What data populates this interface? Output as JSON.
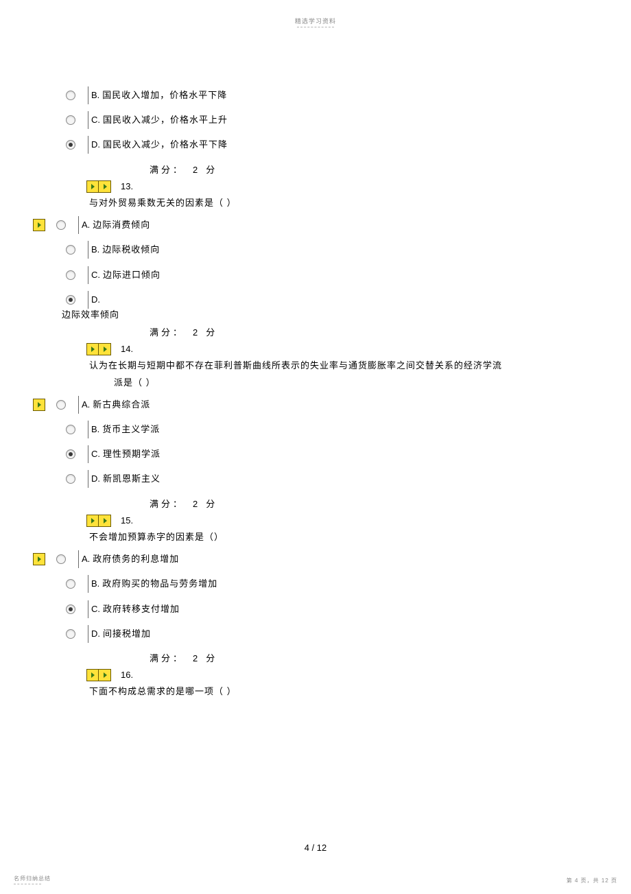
{
  "header": {
    "label": "精选学习资料"
  },
  "q12_trailing_options": [
    {
      "letter": "B.",
      "text": "国民收入增加，价格水平下降",
      "checked": false
    },
    {
      "letter": "C.",
      "text": "国民收入减少，价格水平上升",
      "checked": false
    },
    {
      "letter": "D.",
      "text": "国民收入减少，价格水平下降",
      "checked": true
    }
  ],
  "score": {
    "label": "满分：",
    "value": "2",
    "unit": "分"
  },
  "q13": {
    "number": "13.",
    "text": "与对外贸易乘数无关的因素是（                     ）",
    "options": [
      {
        "letter": "A.",
        "text": "边际消费倾向",
        "checked": false,
        "leading_arrow": true
      },
      {
        "letter": "B.",
        "text": "边际税收倾向",
        "checked": false
      },
      {
        "letter": "C.",
        "text": "边际进口倾向",
        "checked": false
      },
      {
        "letter": "D.",
        "text": "",
        "checked": true
      }
    ],
    "wrapped_text": "边际效率倾向"
  },
  "q14": {
    "number": "14.",
    "text": "认为在长期与短期中都不存在菲利普斯曲线所表示的失业率与通货膨胀率之间交替关系的经济学流",
    "text_line2": "派是（                     ）",
    "options": [
      {
        "letter": "A.",
        "text": "新古典综合派",
        "checked": false,
        "leading_arrow": true
      },
      {
        "letter": "B.",
        "text": "货币主义学派",
        "checked": false
      },
      {
        "letter": "C.",
        "text": "理性预期学派",
        "checked": true
      },
      {
        "letter": "D.",
        "text": "新凯恩斯主义",
        "checked": false
      }
    ]
  },
  "q15": {
    "number": "15.",
    "text": "不会增加预算赤字的因素是（）",
    "options": [
      {
        "letter": "A.",
        "text": "政府债务的利息增加",
        "checked": false,
        "leading_arrow": true
      },
      {
        "letter": "B.",
        "text": "政府购买的物品与劳务增加",
        "checked": false
      },
      {
        "letter": "C.",
        "text": "政府转移支付增加",
        "checked": true
      },
      {
        "letter": "D.",
        "text": "间接税增加",
        "checked": false
      }
    ]
  },
  "q16": {
    "number": "16.",
    "text": "下面不构成总需求的是哪一项（                             ）"
  },
  "pager": "4 / 12",
  "footer": {
    "left": "名师归纳总结",
    "right": "第 4 页，共 12 页"
  }
}
